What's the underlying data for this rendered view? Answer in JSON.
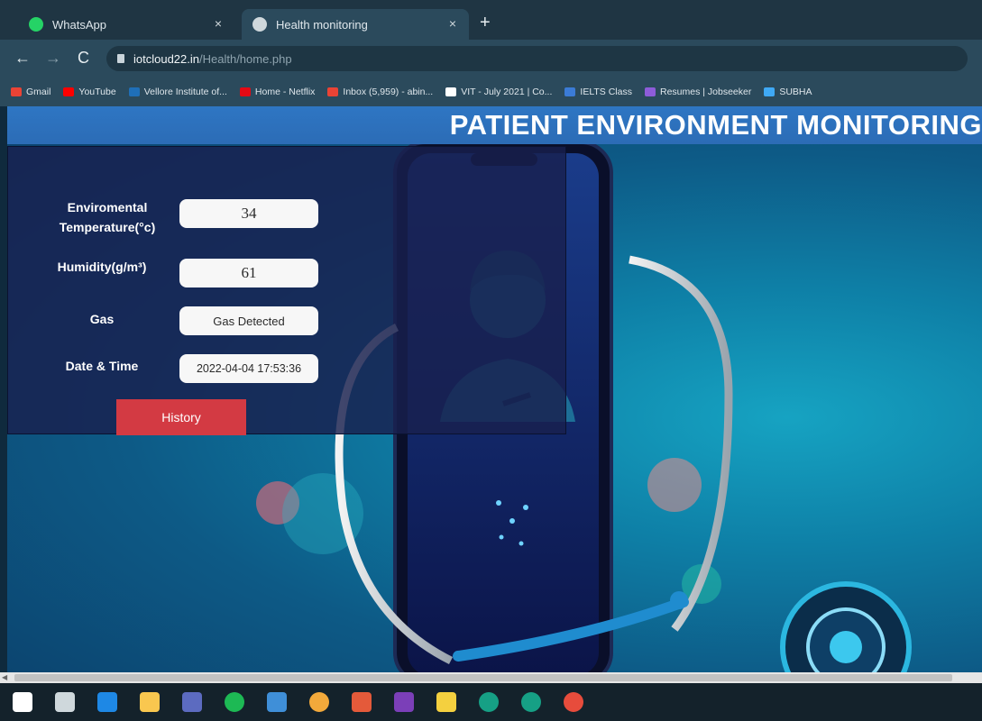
{
  "browser": {
    "tabs": [
      {
        "title": "WhatsApp",
        "close": "×"
      },
      {
        "title": "Health monitoring",
        "close": "×"
      }
    ],
    "new_tab": "+",
    "nav": {
      "back": "←",
      "forward": "→",
      "reload": "C"
    },
    "url_domain": "iotcloud22.in",
    "url_path": "/Health/home.php",
    "bookmarks": [
      {
        "label": "Gmail",
        "color": "#ea4335"
      },
      {
        "label": "YouTube",
        "color": "#ff0000"
      },
      {
        "label": "Vellore Institute of...",
        "color": "#1f6fb8"
      },
      {
        "label": "Home - Netflix",
        "color": "#e50914"
      },
      {
        "label": "Inbox (5,959) - abin...",
        "color": "#ea4335"
      },
      {
        "label": "VIT - July 2021 | Co...",
        "color": "#ffffff"
      },
      {
        "label": "IELTS Class",
        "color": "#3b7bd6"
      },
      {
        "label": "Resumes | Jobseeker",
        "color": "#8e5cd9"
      },
      {
        "label": "SUBHA",
        "color": "#3fa9f5"
      }
    ]
  },
  "page": {
    "title": "PATIENT ENVIRONMENT MONITORING",
    "temperature": {
      "label": "Enviromental Temperature(°c)",
      "value": "34"
    },
    "humidity": {
      "label": "Humidity(g/m³)",
      "value": "61"
    },
    "gas": {
      "label": "Gas",
      "value": "Gas Detected"
    },
    "datetime": {
      "label": "Date & Time",
      "value": "2022-04-04 17:53:36"
    },
    "history_button": "History"
  },
  "colors": {
    "header_band": "#2e76c3",
    "panel": "#18204e",
    "history_button": "#d33a43"
  },
  "taskbar_icons": [
    "windows-start-icon",
    "task-view-icon",
    "mail-icon",
    "file-explorer-icon",
    "notepad-icon",
    "spotify-icon",
    "photos-icon",
    "chrome-icon",
    "pdf-icon",
    "onenote-icon",
    "sticky-notes-icon",
    "arduino-icon",
    "arduino-icon",
    "chrome-canary-icon"
  ]
}
